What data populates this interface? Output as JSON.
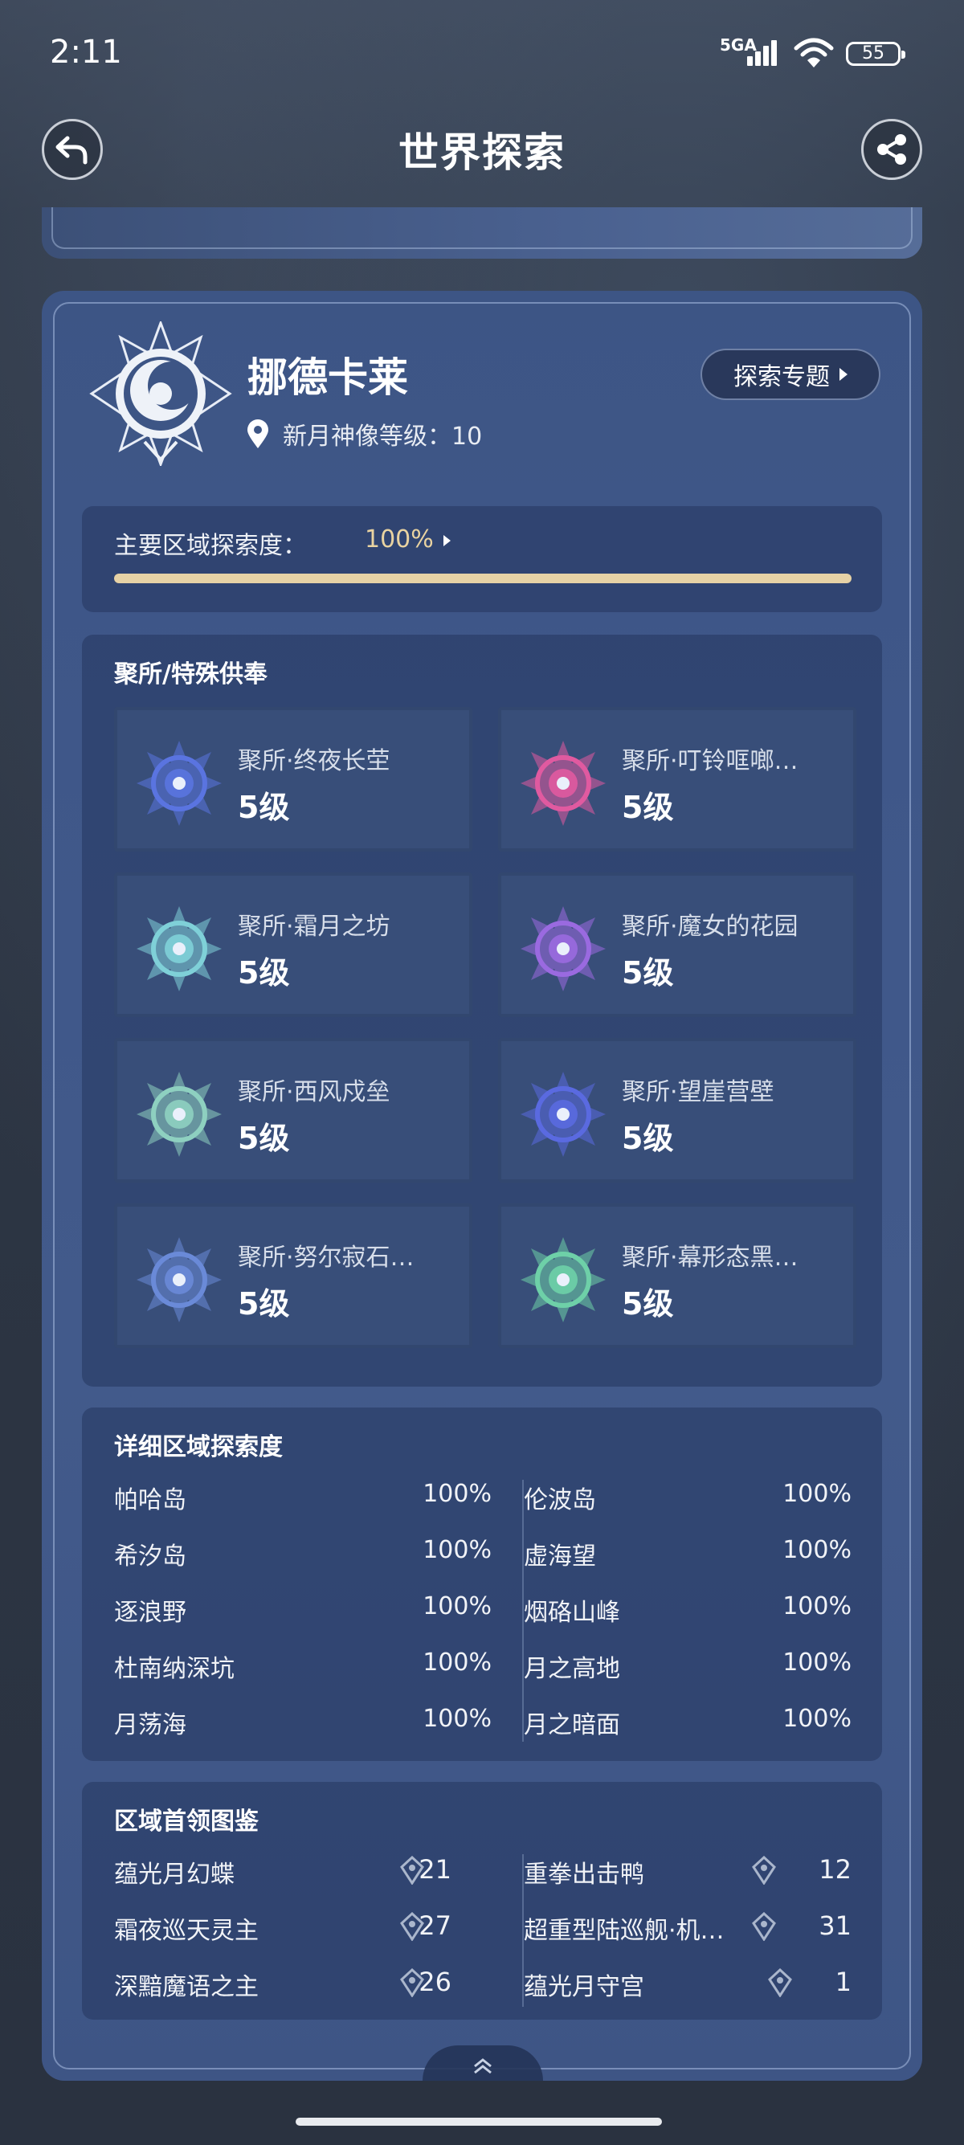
{
  "status_bar": {
    "time": "2:11",
    "network": "5GA",
    "battery": "55"
  },
  "header": {
    "title": "世界探索"
  },
  "region": {
    "name": "挪德卡莱",
    "statue_level_label": "新月神像等级：10",
    "topic_button": "探索专题"
  },
  "exploration": {
    "label": "主要区域探索度：",
    "value": "100%",
    "progress": 1.0
  },
  "camps": {
    "title": "聚所/特殊供奉",
    "items": [
      {
        "name": "聚所·终夜长茔",
        "level": "5级",
        "icon": "blue-compass-icon",
        "color": "#5a74e0"
      },
      {
        "name": "聚所·叮铃哐啷…",
        "level": "5级",
        "icon": "pink-heart-emblem-icon",
        "color": "#e05aa0"
      },
      {
        "name": "聚所·霜月之坊",
        "level": "5级",
        "icon": "frost-moon-emblem-icon",
        "color": "#7fd0d8"
      },
      {
        "name": "聚所·魔女的花园",
        "level": "5级",
        "icon": "witch-garden-emblem-icon",
        "color": "#9a6ae0"
      },
      {
        "name": "聚所·西风戍垒",
        "level": "5级",
        "icon": "wing-shield-emblem-icon",
        "color": "#8ed0c0"
      },
      {
        "name": "聚所·望崖营壁",
        "level": "5级",
        "icon": "cliff-compass-icon",
        "color": "#5a6ae0"
      },
      {
        "name": "聚所·努尔寂石…",
        "level": "5级",
        "icon": "stone-diamond-icon",
        "color": "#6a8ad8"
      },
      {
        "name": "聚所·幕形态黑…",
        "level": "5级",
        "icon": "tree-emblem-icon",
        "color": "#6ed0a8"
      }
    ]
  },
  "detail": {
    "title": "详细区域探索度",
    "left": [
      {
        "name": "帕哈岛",
        "pct": "100%"
      },
      {
        "name": "希汐岛",
        "pct": "100%"
      },
      {
        "name": "逐浪野",
        "pct": "100%"
      },
      {
        "name": "杜南纳深坑",
        "pct": "100%"
      },
      {
        "name": "月荡海",
        "pct": "100%"
      }
    ],
    "right": [
      {
        "name": "伦波岛",
        "pct": "100%"
      },
      {
        "name": "虚海望",
        "pct": "100%"
      },
      {
        "name": "烟硌山峰",
        "pct": "100%"
      },
      {
        "name": "月之高地",
        "pct": "100%"
      },
      {
        "name": "月之暗面",
        "pct": "100%"
      }
    ]
  },
  "bosses": {
    "title": "区域首领图鉴",
    "left": [
      {
        "name": "蕴光月幻蝶",
        "count": "21"
      },
      {
        "name": "霜夜巡天灵主",
        "count": "27"
      },
      {
        "name": "深黯魔语之主",
        "count": "26"
      }
    ],
    "right": [
      {
        "name": "重拳出击鸭",
        "count": "12"
      },
      {
        "name": "超重型陆巡舰·机…",
        "count": "31"
      },
      {
        "name": "蕴光月守宫",
        "count": "1"
      }
    ]
  }
}
